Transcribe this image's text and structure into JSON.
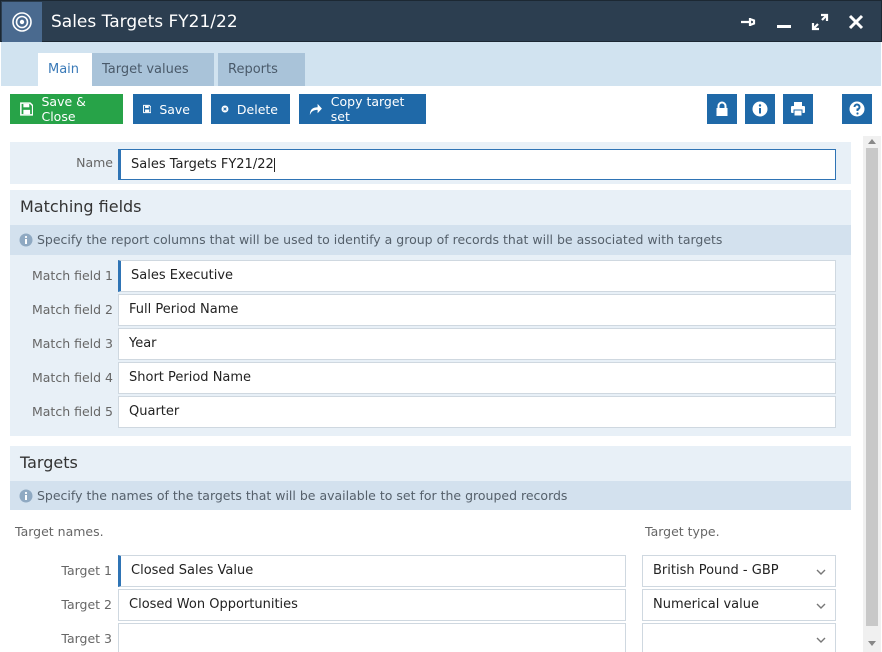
{
  "window": {
    "title": "Sales Targets FY21/22",
    "controls": [
      "pin-icon",
      "minimize-icon",
      "maximize-icon",
      "close-icon"
    ]
  },
  "tabs": [
    {
      "label": "Main",
      "active": true
    },
    {
      "label": "Target values",
      "active": false
    },
    {
      "label": "Reports",
      "active": false
    }
  ],
  "toolbar": {
    "save_close": "Save & Close",
    "save": "Save",
    "delete": "Delete",
    "copy": "Copy target set",
    "icon_buttons": [
      "lock-icon",
      "info-icon",
      "print-icon",
      "help-icon"
    ]
  },
  "name_field": {
    "label": "Name",
    "value": "Sales Targets FY21/22"
  },
  "matching": {
    "heading": "Matching fields",
    "info": "Specify the report columns that will be used to identify a group of records that will be associated with targets",
    "fields": [
      {
        "label": "Match field 1",
        "value": "Sales Executive"
      },
      {
        "label": "Match field 2",
        "value": "Full Period Name"
      },
      {
        "label": "Match field 3",
        "value": "Year"
      },
      {
        "label": "Match field 4",
        "value": "Short Period Name"
      },
      {
        "label": "Match field 5",
        "value": "Quarter"
      }
    ]
  },
  "targets": {
    "heading": "Targets",
    "info": "Specify the names of the targets that will be available to set for the grouped records",
    "names_header": "Target names.",
    "type_header": "Target type.",
    "rows": [
      {
        "label": "Target 1",
        "name": "Closed Sales Value",
        "type": "British Pound - GBP"
      },
      {
        "label": "Target 2",
        "name": "Closed Won Opportunities",
        "type": "Numerical value"
      },
      {
        "label": "Target 3",
        "name": "",
        "type": ""
      }
    ]
  },
  "colors": {
    "titlebar": "#2c3e50",
    "primary_button": "#1f69a8",
    "success_button": "#27a348",
    "panel": "#e8f0f7",
    "info_bar": "#d3e1ee",
    "focus_accent": "#2f74b5"
  }
}
